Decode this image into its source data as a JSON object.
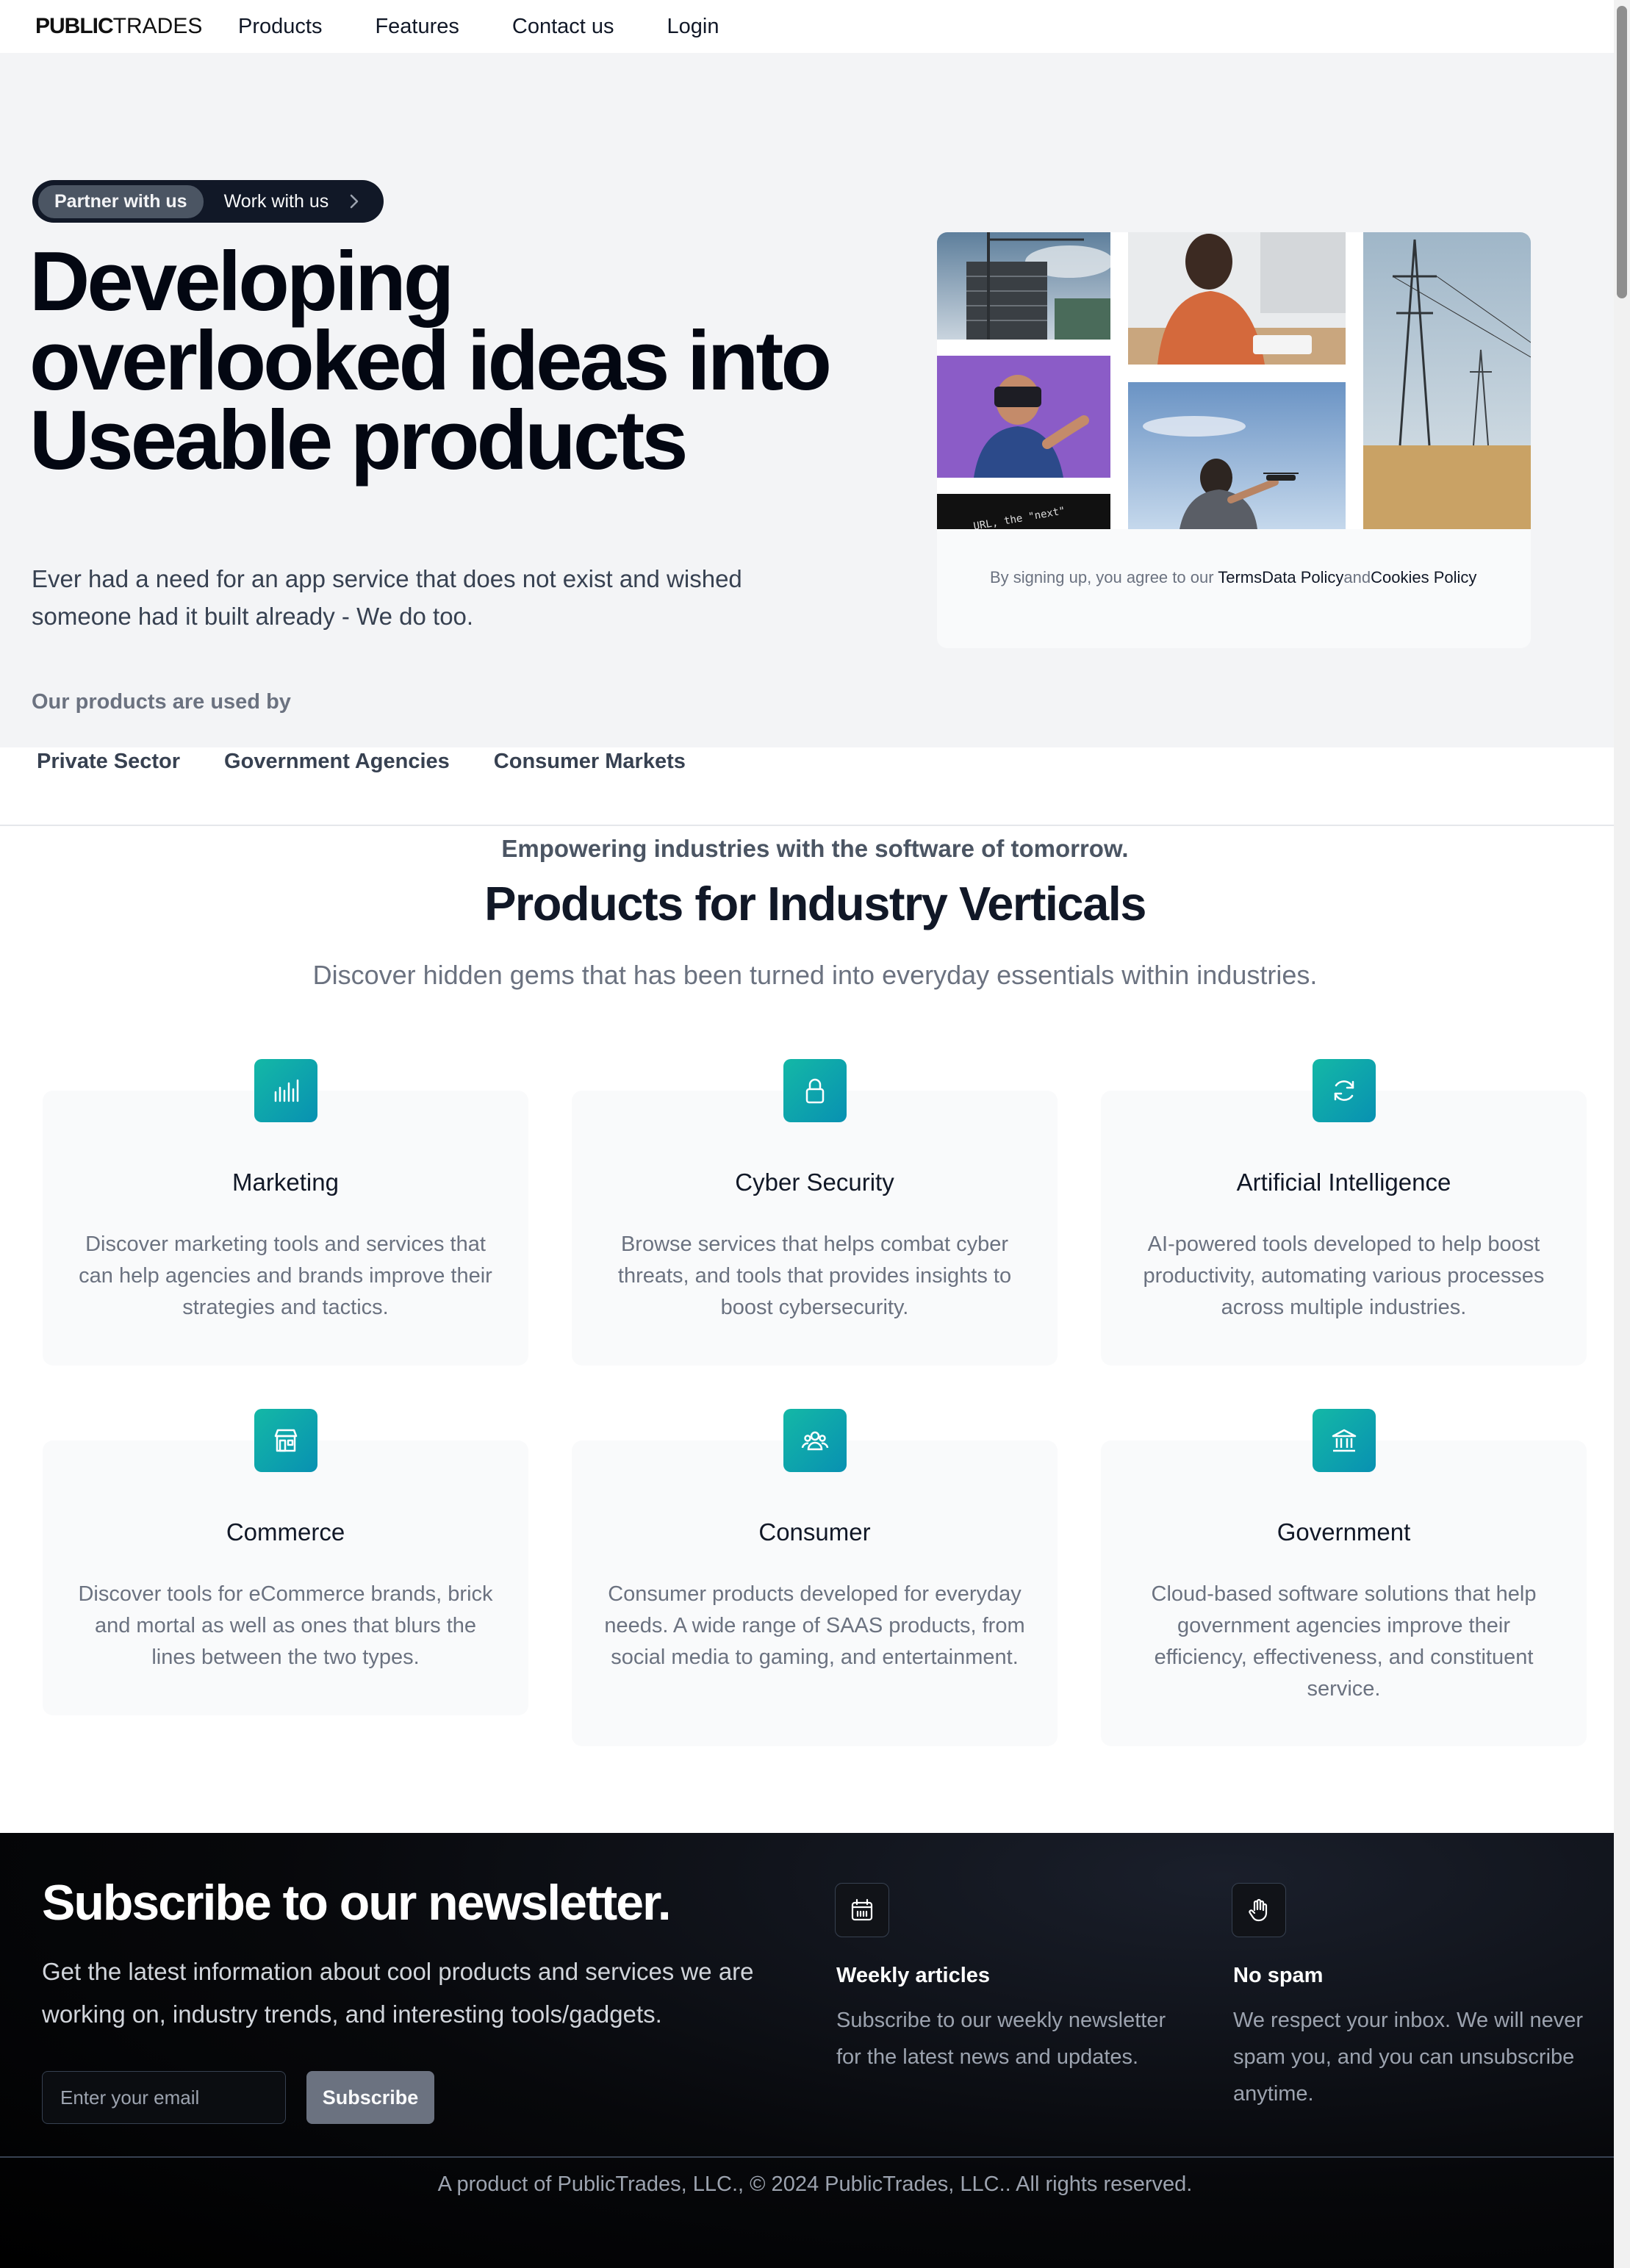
{
  "nav": {
    "logo_bold": "PUBLIC",
    "logo_light": "TRADES",
    "links": [
      "Products",
      "Features",
      "Contact us",
      "Login"
    ]
  },
  "hero": {
    "pill_primary": "Partner with us",
    "pill_secondary": "Work with us",
    "title_lines": [
      "Developing",
      "overlooked ideas into",
      "Useable products"
    ],
    "subtitle": "Ever had a need for an app service that does not exist and wished someone had it built already - We do too.",
    "used_by_label": "Our products are used by",
    "sectors": [
      "Private Sector",
      "Government Agencies",
      "Consumer Markets"
    ]
  },
  "signup": {
    "prefix": "By signing up, you agree to our ",
    "terms": "Terms",
    "data_policy": "Data Policy",
    "and": "and",
    "cookies": "Cookies Policy"
  },
  "products": {
    "eyebrow": "Empowering industries with the software of tomorrow.",
    "title": "Products for Industry Verticals",
    "subtitle": "Discover hidden gems that has been turned into everyday essentials within industries.",
    "cards": [
      {
        "title": "Marketing",
        "icon": "chart-bars-icon",
        "text": "Discover marketing tools and services that can help agencies and brands improve their strategies and tactics."
      },
      {
        "title": "Cyber Security",
        "icon": "lock-icon",
        "text": "Browse services that helps combat cyber threats, and tools that provides insights to boost cybersecurity."
      },
      {
        "title": "Artificial Intelligence",
        "icon": "refresh-icon",
        "text": "AI-powered tools developed to help boost productivity, automating various processes across multiple industries."
      },
      {
        "title": "Commerce",
        "icon": "storefront-icon",
        "text": "Discover tools for eCommerce brands, brick and mortal as well as ones that blurs the lines between the two types."
      },
      {
        "title": "Consumer",
        "icon": "users-icon",
        "text": "Consumer products developed for everyday needs. A wide range of SAAS products, from social media to gaming, and entertainment."
      },
      {
        "title": "Government",
        "icon": "bank-icon",
        "text": "Cloud-based software solutions that help government agencies improve their efficiency, effectiveness, and constituent service."
      }
    ]
  },
  "newsletter": {
    "title": "Subscribe to our newsletter.",
    "subtitle": "Get the latest information about cool products and services we are working on, industry trends, and interesting tools/gadgets.",
    "email_placeholder": "Enter your email",
    "button": "Subscribe",
    "features": [
      {
        "title": "Weekly articles",
        "icon": "calendar-icon",
        "text": "Subscribe to our weekly newsletter for the latest news and updates."
      },
      {
        "title": "No spam",
        "icon": "hand-icon",
        "text": "We respect your inbox. We will never spam you, and you can unsubscribe anytime."
      }
    ]
  },
  "footer": {
    "text": "A product of PublicTrades, LLC., © 2024 PublicTrades, LLC.. All rights reserved."
  },
  "colors": {
    "accent_from": "#14b8a6",
    "accent_to": "#0891b2",
    "hero_bg": "#f3f4f6",
    "pill_bg": "#111827",
    "footer_bg": "#000000"
  }
}
